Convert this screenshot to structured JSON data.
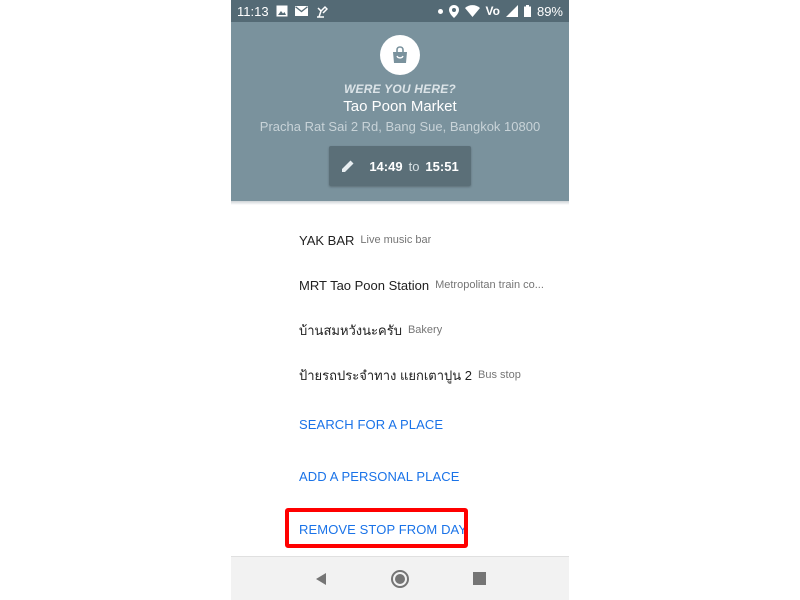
{
  "status_bar": {
    "time": "11:13",
    "network_label": "Vo",
    "battery": "89%"
  },
  "header": {
    "prompt": "WERE YOU HERE?",
    "place_name": "Tao Poon Market",
    "address": "Pracha Rat Sai 2 Rd, Bang Sue, Bangkok 10800",
    "start_time": "14:49",
    "to_label": "to",
    "end_time": "15:51",
    "icon": "shopping-bag-icon",
    "background_color": "#7a929d"
  },
  "suggestions": [
    {
      "name": "YAK BAR",
      "category": "Live music bar"
    },
    {
      "name": "MRT Tao Poon Station",
      "category": "Metropolitan train co..."
    },
    {
      "name": "บ้านสมหวังนะครับ",
      "category": "Bakery"
    },
    {
      "name": "ป้ายรถประจำทาง แยกเตาปูน 2",
      "category": "Bus stop"
    }
  ],
  "actions": {
    "search": "SEARCH FOR A PLACE",
    "add_personal": "ADD A PERSONAL PLACE",
    "remove_stop": "REMOVE STOP FROM DAY",
    "accent_color": "#1a73e8"
  },
  "highlight_color": "#ff0000"
}
